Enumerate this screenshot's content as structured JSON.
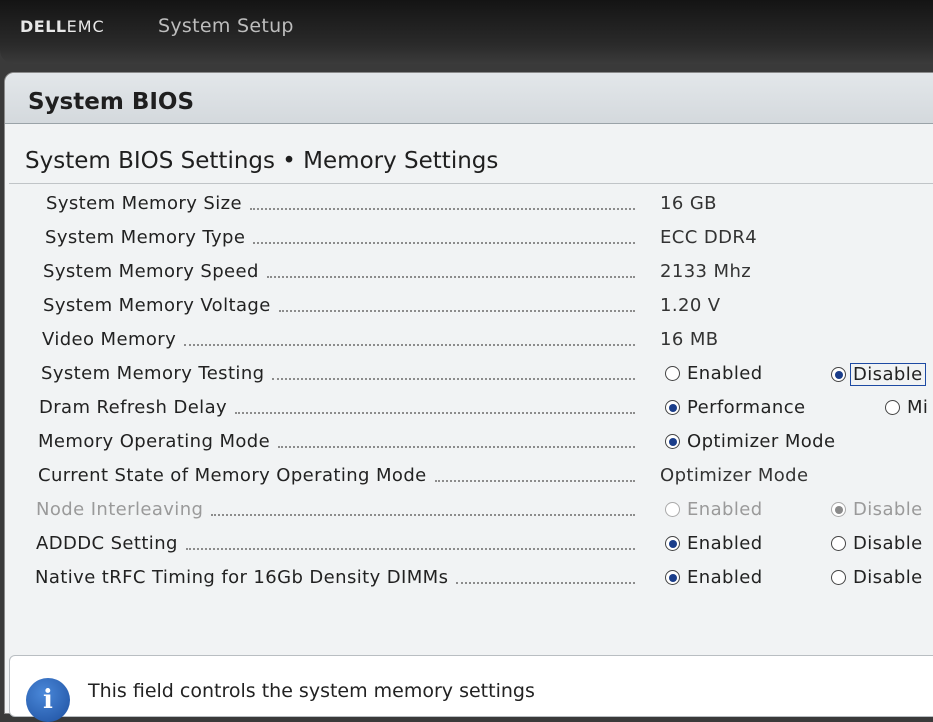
{
  "header": {
    "brand_dell": "DELL",
    "brand_emc": "EMC",
    "app_title": "System Setup"
  },
  "panel": {
    "title": "System BIOS",
    "section_title": "System BIOS Settings • Memory Settings"
  },
  "rows": [
    {
      "label": "System Memory Size",
      "value": "16 GB"
    },
    {
      "label": "System Memory Type",
      "value": "ECC DDR4"
    },
    {
      "label": "System Memory Speed",
      "value": "2133 Mhz"
    },
    {
      "label": "System Memory Voltage",
      "value": "1.20 V"
    },
    {
      "label": "Video Memory",
      "value": "16 MB"
    },
    {
      "label": "System Memory Testing",
      "options": [
        {
          "label": "Enabled",
          "selected": false
        },
        {
          "label": "Disable",
          "selected": true
        }
      ]
    },
    {
      "label": "Dram Refresh Delay",
      "options": [
        {
          "label": "Performance",
          "selected": true
        },
        {
          "label": "Mi",
          "selected": false
        }
      ]
    },
    {
      "label": "Memory Operating Mode",
      "options": [
        {
          "label": "Optimizer Mode",
          "selected": true
        }
      ]
    },
    {
      "label": "Current State of Memory Operating Mode",
      "value": "Optimizer Mode"
    },
    {
      "label": "Node Interleaving",
      "disabled": true,
      "options": [
        {
          "label": "Enabled",
          "selected": false
        },
        {
          "label": "Disable",
          "selected": true
        }
      ]
    },
    {
      "label": "ADDDC Setting",
      "options": [
        {
          "label": "Enabled",
          "selected": true
        },
        {
          "label": "Disable",
          "selected": false
        }
      ]
    },
    {
      "label": "Native tRFC Timing for 16Gb Density DIMMs",
      "options": [
        {
          "label": "Enabled",
          "selected": true
        },
        {
          "label": "Disable",
          "selected": false
        }
      ]
    }
  ],
  "help": {
    "icon": "info-icon",
    "text": "This field controls the system memory settings"
  },
  "colors": {
    "selected_radio": "#1a3d8a",
    "focus_border": "#1d4aa3"
  }
}
